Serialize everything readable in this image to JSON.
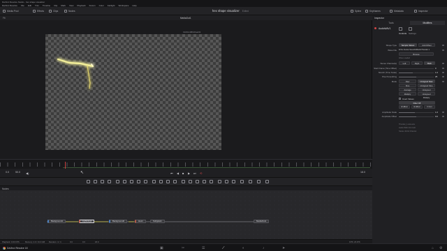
{
  "window": {
    "title": "DaVinci Resolve Studio - hex shape visualizer",
    "menu": [
      "DaVinci Resolve",
      "File",
      "Edit",
      "Trim",
      "Timeline",
      "Clip",
      "Mark",
      "View",
      "Playback",
      "Fusion",
      "Color",
      "Fairlight",
      "Workspace",
      "Help"
    ]
  },
  "toolbar": {
    "media_pool": "Media Pool",
    "effects": "Effects",
    "clips": "Clips",
    "nodes": "Nodes",
    "clip_title": "hex shape visualizer",
    "clip_status": "Edited",
    "spline": "Spline",
    "keyframes": "Keyframes",
    "metadata": "Metadata",
    "inspector": "Inspector"
  },
  "viewer": {
    "zoom": "Fit",
    "label": "MediaOut1",
    "resolution": "1920x1080xfloat32"
  },
  "transport": {
    "start_time": "0.0",
    "end_time": "50.0",
    "current_time": "18.0"
  },
  "nodes_panel": {
    "title": "Nodes",
    "nodes": [
      "Background1",
      "Lightning1",
      "Background2",
      "Hex1",
      "Softglow1",
      "MediaOut1"
    ]
  },
  "status": {
    "playback": "Playback: 0.00 FPS",
    "memory": "Memory: 2.0 / 31.9 GB",
    "renders": "Renders: 4 / 4",
    "frame_a": "0.0",
    "frame_b": "0.0",
    "frame_c": "18.0",
    "fps": "FPS: 23.976"
  },
  "pages": {
    "app_name": "DaVinci Resolve 18",
    "icons": [
      "media-icon",
      "cut-icon",
      "edit-icon",
      "fusion-icon",
      "color-icon",
      "fairlight-icon",
      "deliver-icon"
    ],
    "active_index": 3
  },
  "inspector": {
    "title": "Inspector",
    "tabs": [
      "Tools",
      "Modifiers"
    ],
    "tool_name": "AudioWAV1",
    "subtabs": [
      "Controls",
      "Settings"
    ],
    "source_type_label": "Shape Type",
    "source_type_options": [
      "Sample Values",
      "Add Offset"
    ],
    "wave_file_label": "Wave File",
    "wave_file_value": "E:\\Fu Fusion Sound Effects\\Thunder 1",
    "browse": "Browse",
    "status_text": "Wave Loaded",
    "channels_label": "Stereo Channel(s)",
    "channels": [
      "Left",
      "Right",
      "Both"
    ],
    "start_label": "Start Frame (Time Offset)",
    "start_value": "0",
    "stretch_label": "Stretch (Time Scale)",
    "stretch_value": "1.0",
    "smoothing_label": "Pixel Smoothing",
    "smoothing_value": "25",
    "smoothing_fraction": 0.5,
    "mode_label": "Mode",
    "mode_options": [
      "Raw",
      "Unsigned Raw",
      "Sine",
      "Unsigned Sine",
      "Average",
      "Unsigned Average",
      "Multiply",
      "Unsigned Multiply"
    ],
    "invert_label": "Invert Values",
    "filter_label": "Filter Off",
    "db_options": [
      "20 dB/oct",
      "40 dB/oct",
      "8 X/oct"
    ],
    "amp_scale_label": "Amplitude Scale",
    "amp_scale_value": "1.0",
    "amp_offset_label": "Amplitude Offset",
    "amp_offset_value": "0.0",
    "footer_lines": [
      "Thunder_1.wav.wav",
      "Audio WAV 44.1 kHz",
      "Stereo 16-bit Channel"
    ]
  }
}
